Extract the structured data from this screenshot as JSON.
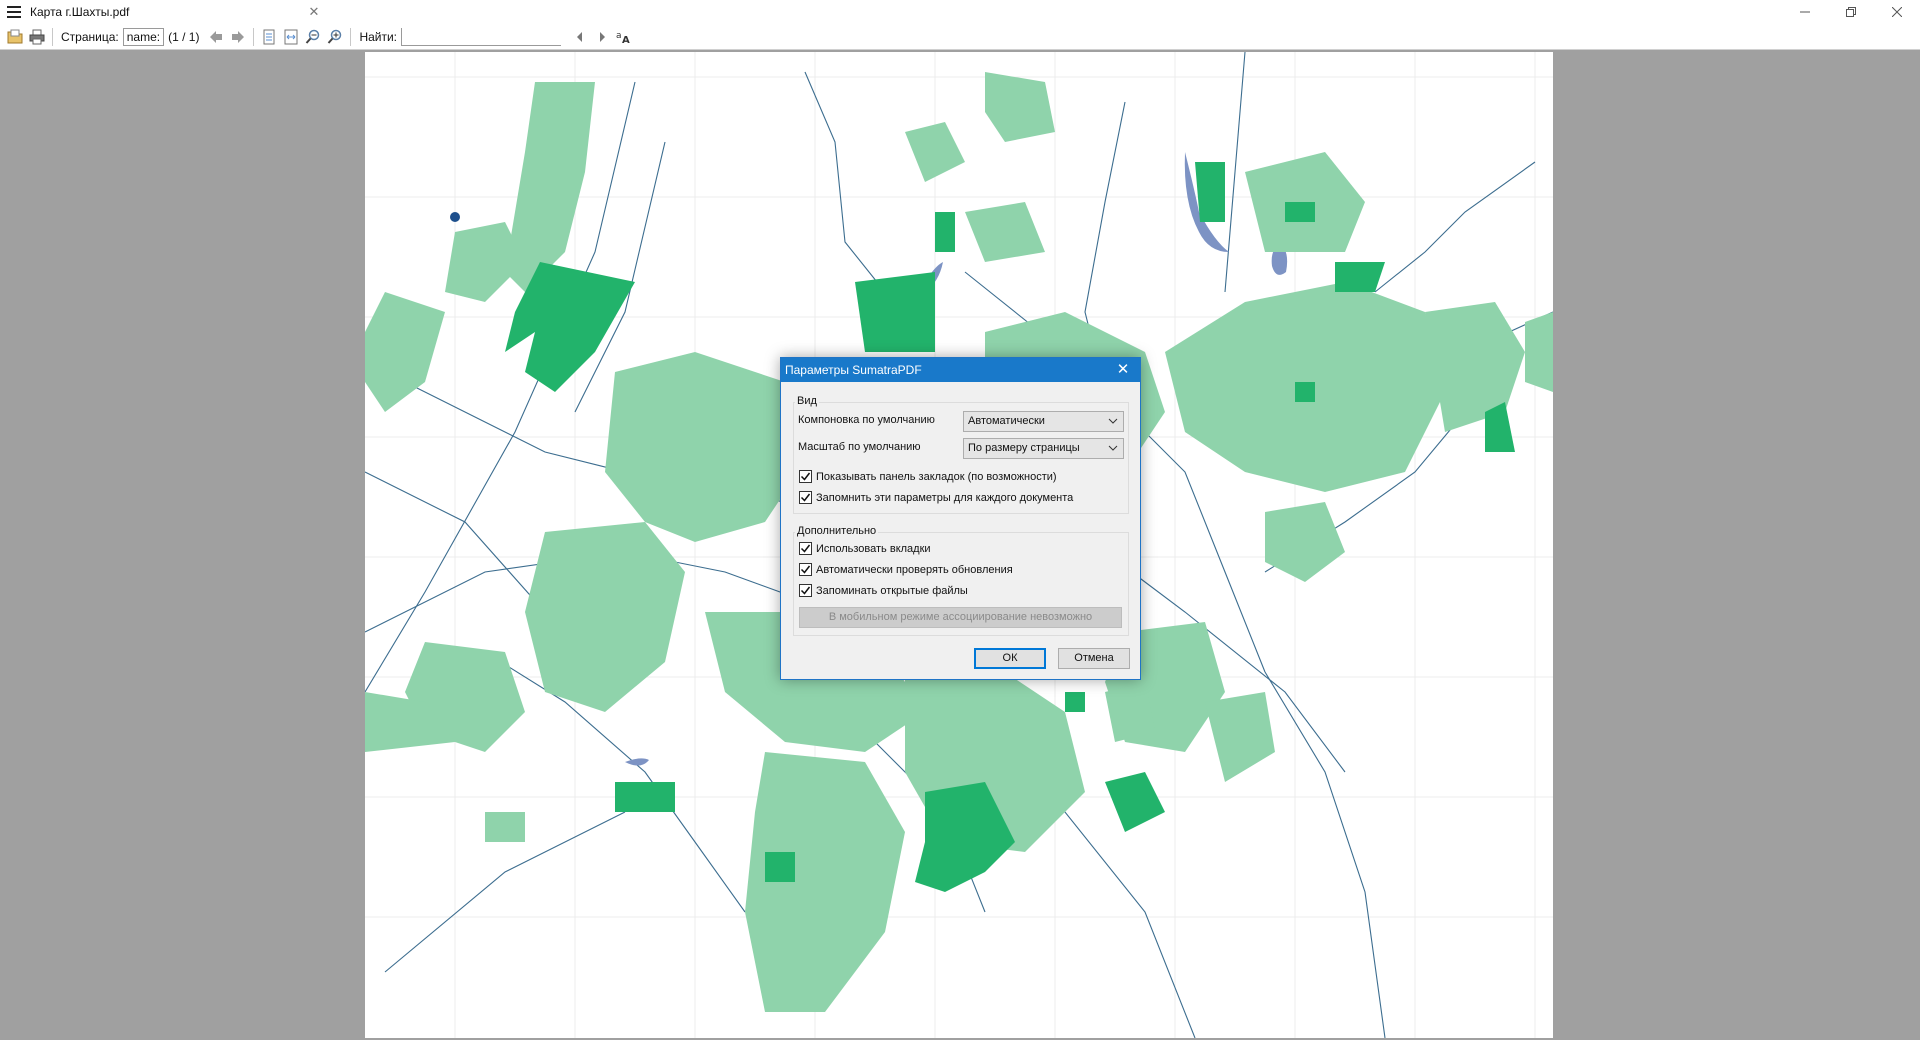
{
  "window": {
    "tab_title": "Карта г.Шахты.pdf",
    "icons": {
      "menu": "hamburger-icon",
      "close_tab": "close-icon",
      "minimize": "minimize-icon",
      "restore": "restore-icon",
      "close": "close-icon"
    }
  },
  "toolbar": {
    "page_label": "Страница:",
    "page_value": "name:",
    "page_count": "(1 / 1)",
    "find_label": "Найти:",
    "find_value": "",
    "icons": [
      "open-icon",
      "print-icon",
      "back-icon",
      "forward-icon",
      "fit-page-icon",
      "fit-width-icon",
      "zoom-out-icon",
      "zoom-in-icon",
      "find-prev-icon",
      "find-next-icon",
      "match-case-icon"
    ]
  },
  "dialog": {
    "title": "Параметры SumatraPDF",
    "view_group": {
      "title": "Вид",
      "layout_label": "Компоновка по умолчанию",
      "layout_value": "Автоматически",
      "zoom_label": "Масштаб по умолчанию",
      "zoom_value": "По размеру страницы",
      "show_bookmarks": "Показывать панель закладок (по возможности)",
      "remember_settings": "Запомнить эти параметры для каждого документа"
    },
    "advanced_group": {
      "title": "Дополнительно",
      "use_tabs": "Использовать вкладки",
      "auto_update": "Автоматически проверять обновления",
      "remember_files": "Запоминать открытые файлы",
      "association_note": "В мобильном режиме ассоциирование невозможно"
    },
    "ok": "ОК",
    "cancel": "Отмена"
  },
  "colors": {
    "accent": "#1979ca",
    "map_blocks": "#8fd3ab",
    "map_parks": "#22b36b",
    "map_water": "#7d93c4",
    "map_roads": "#3c6d8f"
  }
}
